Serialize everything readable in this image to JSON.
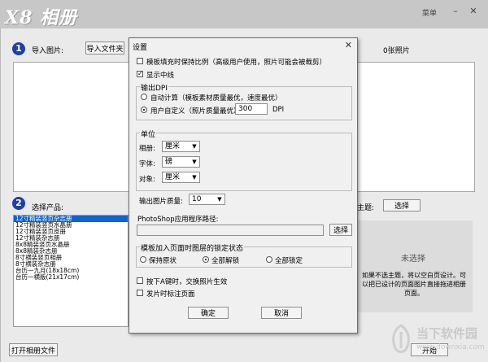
{
  "app": {
    "logo_text": "X8 相册",
    "menu_label": "菜单",
    "min_glyph": "–",
    "close_glyph": "✕"
  },
  "step1": {
    "num": "1",
    "label": "导入图片:",
    "import_button": "导入文件夹",
    "photo_count": "0张照片"
  },
  "step2": {
    "num": "2",
    "label": "选择产品:",
    "products": [
      "12寸精装竖页杂志册",
      "12寸精装竖页水晶册",
      "12寸精装竖页皮册",
      "12寸精装杂志册",
      "8x8精装竖页水晶册",
      "8x8精装杂志册",
      "8寸横装竖页相册",
      "8寸横装杂志册",
      "台历一九月(18x18cm)",
      "台历一横版(21x17cm)"
    ],
    "theme_label": "主题:",
    "theme_button": "选择"
  },
  "preview": {
    "title": "未选择",
    "hint": "如果不选主题，将以空白页设计。可以把已设计的页面图片直接拖进相册页面。"
  },
  "bottom": {
    "open_button": "打开相册文件",
    "start_button": "开始"
  },
  "watermark": {
    "text": "当下软件园",
    "url": "www.downxia.com"
  },
  "dialog": {
    "title": "设置",
    "close_glyph": "✕",
    "keep_ratio_label": "模板填充时保持比例（高级用户使用，照片可能会被裁剪）",
    "keep_ratio_checked": false,
    "show_center_label": "显示中线",
    "show_center_checked": true,
    "dpi_group": "输出DPI",
    "dpi_auto_label": "自动计算（模板素材质量最优，速度最优）",
    "dpi_custom_label": "用户自定义（照片质量最优）",
    "dpi_value": "300",
    "dpi_unit": "DPI",
    "unit_group": "单位",
    "album_label": "相册:",
    "album_unit": "厘米",
    "font_label": "字体:",
    "font_unit": "磅",
    "object_label": "对象:",
    "object_unit": "厘米",
    "quality_label": "输出图片质量:",
    "quality_value": "10",
    "ps_path_label": "PhotoShop应用程序路径:",
    "ps_path_value": "",
    "ps_select_button": "选择",
    "lock_group": "模板加入页面时图层的锁定状态",
    "lock_keep": "保持原状",
    "lock_unlock": "全部解锁",
    "lock_all": "全部锁定",
    "alt_swap_label": "按下A键时，交换照片生效",
    "alt_swap_checked": false,
    "mark_page_label": "发片时标注页面",
    "mark_page_checked": false,
    "ok_button": "确定",
    "cancel_button": "取消"
  }
}
